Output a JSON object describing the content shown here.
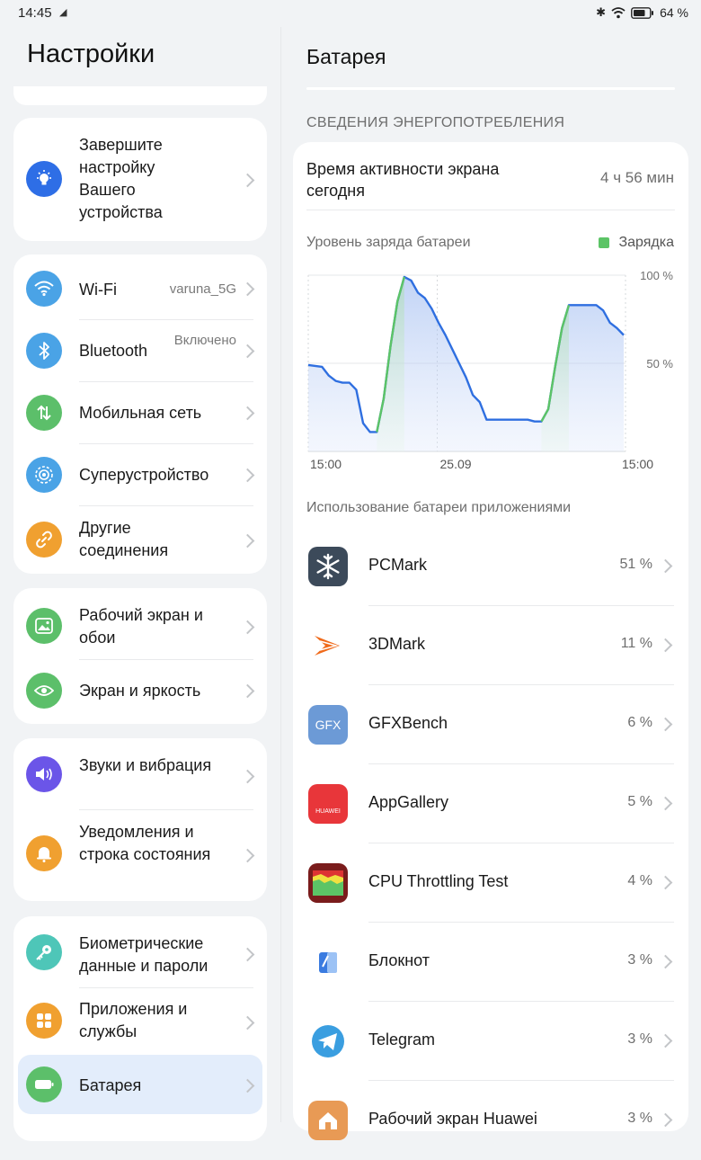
{
  "status": {
    "time": "14:45",
    "battery": "64 %"
  },
  "left": {
    "title": "Настройки",
    "setup": {
      "label": "Завершите настройку Вашего устройства"
    },
    "group1": [
      {
        "label": "Wi-Fi",
        "value": "varuna_5G",
        "icon": "wifi-icon",
        "color": "#4aa3e6"
      },
      {
        "label": "Bluetooth",
        "value": "Включено",
        "icon": "bluetooth-icon",
        "color": "#4aa3e6"
      },
      {
        "label": "Мобильная сеть",
        "value": "",
        "icon": "mobile-network-icon",
        "color": "#5cbf6a"
      },
      {
        "label": "Суперустройство",
        "value": "",
        "icon": "superdevice-icon",
        "color": "#4aa3e6"
      },
      {
        "label": "Другие соединения",
        "value": "",
        "icon": "link-icon",
        "color": "#f0a030"
      }
    ],
    "group2": [
      {
        "label": "Рабочий экран и обои",
        "icon": "wallpaper-icon",
        "color": "#5cbf6a"
      },
      {
        "label": "Экран и яркость",
        "icon": "eye-icon",
        "color": "#5cbf6a"
      }
    ],
    "group3": [
      {
        "label": "Звуки и вибрация",
        "icon": "sound-icon",
        "color": "#6b55e8"
      },
      {
        "label": "Уведомления и строка состояния",
        "icon": "bell-icon",
        "color": "#f0a030"
      }
    ],
    "group4": [
      {
        "label": "Биометрические данные и пароли",
        "icon": "key-icon",
        "color": "#4ec6b8"
      },
      {
        "label": "Приложения и службы",
        "icon": "apps-icon",
        "color": "#f0a030"
      },
      {
        "label": "Батарея",
        "icon": "battery-icon",
        "color": "#5cbf6a"
      }
    ]
  },
  "right": {
    "title": "Батарея",
    "section": "СВЕДЕНИЯ ЭНЕРГОПОТРЕБЛЕНИЯ",
    "screen_time_label": "Время активности экрана сегодня",
    "screen_time_value": "4 ч 56 мин",
    "chart_caption": "Уровень заряда батареи",
    "legend": "Зарядка",
    "usage_caption": "Использование батареи приложениями",
    "apps": [
      {
        "name": "PCMark",
        "pct": "51 %",
        "icon": "pcmark-icon"
      },
      {
        "name": "3DMark",
        "pct": "11 %",
        "icon": "3dmark-icon"
      },
      {
        "name": "GFXBench",
        "pct": "6 %",
        "icon": "gfxbench-icon"
      },
      {
        "name": "AppGallery",
        "pct": "5 %",
        "icon": "appgallery-icon"
      },
      {
        "name": "CPU Throttling Test",
        "pct": "4 %",
        "icon": "cpu-throttling-icon"
      },
      {
        "name": "Блокнот",
        "pct": "3 %",
        "icon": "notepad-icon"
      },
      {
        "name": "Telegram",
        "pct": "3 %",
        "icon": "telegram-icon"
      },
      {
        "name": "Рабочий экран Huawei",
        "pct": "3 %",
        "icon": "huawei-home-icon"
      }
    ]
  },
  "chart_data": {
    "type": "area",
    "title": "Уровень заряда батареи",
    "x_ticks": [
      "15:00",
      "25.09",
      "15:00"
    ],
    "y_ticks": [
      "100 %",
      "50 %"
    ],
    "ylim": [
      0,
      100
    ],
    "series": [
      {
        "name": "Уровень заряда",
        "points": [
          [
            0,
            49
          ],
          [
            2,
            48
          ],
          [
            3,
            43
          ],
          [
            4,
            40
          ],
          [
            5,
            39
          ],
          [
            6,
            39
          ],
          [
            7,
            35
          ],
          [
            8,
            16
          ],
          [
            9,
            11
          ],
          [
            10,
            11
          ],
          [
            11,
            30
          ],
          [
            12,
            60
          ],
          [
            13,
            85
          ],
          [
            14,
            99
          ],
          [
            15,
            97
          ],
          [
            16,
            90
          ],
          [
            17,
            87
          ],
          [
            18,
            81
          ],
          [
            19,
            73
          ],
          [
            20,
            66
          ],
          [
            21,
            58
          ],
          [
            22,
            50
          ],
          [
            23,
            42
          ],
          [
            24,
            32
          ],
          [
            25,
            28
          ],
          [
            26,
            18
          ],
          [
            27,
            18
          ],
          [
            28,
            18
          ],
          [
            29,
            18
          ],
          [
            30,
            18
          ],
          [
            31,
            18
          ],
          [
            32,
            18
          ],
          [
            33,
            17
          ],
          [
            34,
            17
          ],
          [
            35,
            24
          ],
          [
            36,
            48
          ],
          [
            37,
            70
          ],
          [
            38,
            83
          ],
          [
            39,
            83
          ],
          [
            40,
            83
          ],
          [
            41,
            83
          ],
          [
            42,
            83
          ],
          [
            43,
            80
          ],
          [
            44,
            73
          ],
          [
            45,
            70
          ],
          [
            46,
            66
          ]
        ]
      }
    ],
    "charging_segments": [
      [
        10,
        14
      ],
      [
        34,
        38
      ]
    ]
  }
}
